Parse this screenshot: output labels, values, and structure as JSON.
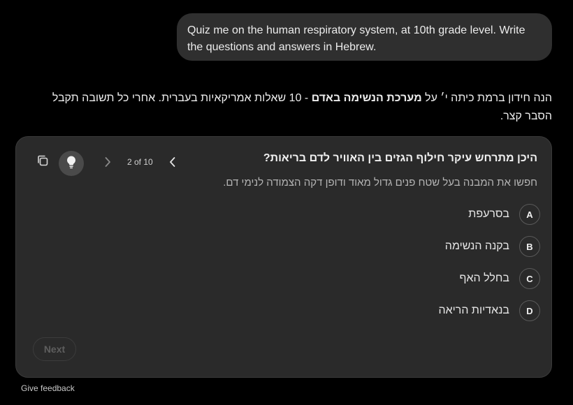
{
  "user_message": {
    "text": "Quiz me on the human respiratory system, at 10th grade level. Write the questions and answers in Hebrew."
  },
  "assistant_intro": {
    "before_bold": "הנה חידון ברמת כיתה י׳ על ",
    "bold": "מערכת הנשימה באדם",
    "after_bold": " - 10 שאלות אמריקאיות בעברית. אחרי כל תשובה תקבל הסבר קצר."
  },
  "quiz": {
    "counter": "2 of 10",
    "question": "היכן מתרחש עיקר חילוף הגזים בין האוויר לדם בריאות?",
    "hint": "חפשו את המבנה בעל שטח פנים גדול מאוד ודופן דקה הצמודה לנימי דם.",
    "options": [
      {
        "letter": "A",
        "text": "בסרעפת"
      },
      {
        "letter": "B",
        "text": "בקנה הנשימה"
      },
      {
        "letter": "C",
        "text": "בחלל האף"
      },
      {
        "letter": "D",
        "text": "בנאדיות הריאה"
      }
    ],
    "next_label": "Next",
    "icons": {
      "copy": "copy-icon",
      "hint": "lightbulb-icon",
      "next": "chevron-right-icon",
      "prev": "chevron-left-icon"
    }
  },
  "footer": {
    "feedback_label": "Give feedback"
  }
}
